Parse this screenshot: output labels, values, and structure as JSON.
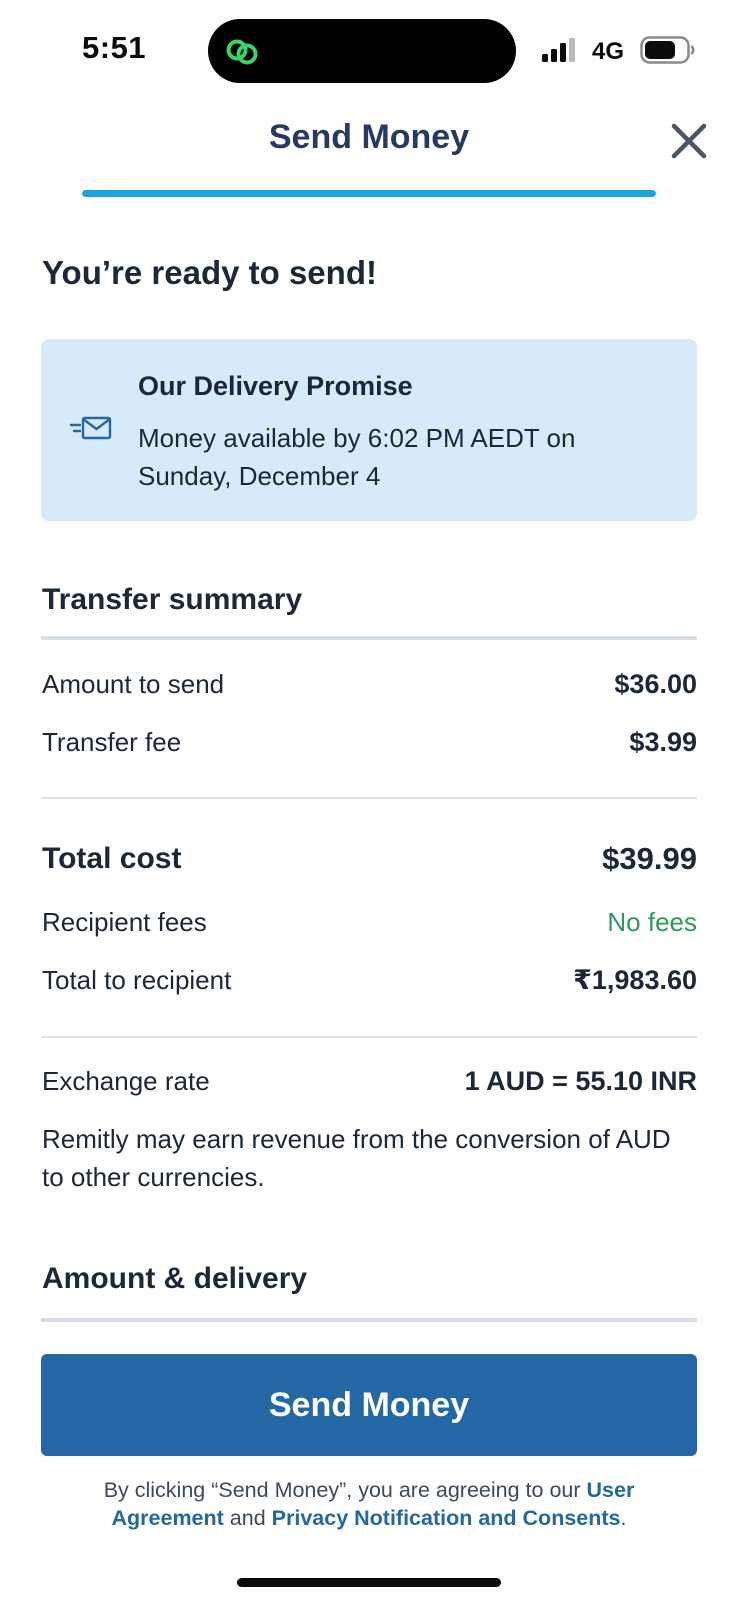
{
  "status_bar": {
    "time": "5:51",
    "network": "4G",
    "island_icon": "link-circles-icon",
    "signal_icon": "cellular-signal-icon",
    "battery_icon": "battery-icon"
  },
  "header": {
    "title": "Send Money",
    "close_icon": "close-icon",
    "progress": 1.0
  },
  "heading": "You’re ready to send!",
  "promise": {
    "icon": "envelope-delivery-icon",
    "title": "Our Delivery Promise",
    "text": "Money available by 6:02 PM AEDT on Sunday, December 4"
  },
  "summary": {
    "title": "Transfer summary",
    "amount_label": "Amount to send",
    "amount_value": "$36.00",
    "fee_label": "Transfer fee",
    "fee_value": "$3.99",
    "total_cost_label": "Total cost",
    "total_cost_value": "$39.99",
    "recipient_fees_label": "Recipient fees",
    "recipient_fees_value": "No fees",
    "total_recipient_label": "Total to recipient",
    "total_recipient_value": "₹1,983.60",
    "exchange_label": "Exchange rate",
    "exchange_value": "1 AUD = 55.10 INR",
    "disclaimer": "Remitly may earn revenue from the conversion of AUD to other currencies."
  },
  "delivery": {
    "title": "Amount & delivery"
  },
  "action": {
    "send_label": "Send Money"
  },
  "legal": {
    "prefix": "By clicking “Send Money”, you are agreeing to our ",
    "link_user_agreement": "User Agreement",
    "middle": " and ",
    "link_privacy": "Privacy Notification and Consents",
    "suffix": "."
  },
  "colors": {
    "brand_blue": "#2368a4",
    "progress_blue": "#1ba4e0",
    "card_bg": "#d5eafa",
    "positive_green": "#2e9a5a",
    "title_navy": "#283a63"
  }
}
